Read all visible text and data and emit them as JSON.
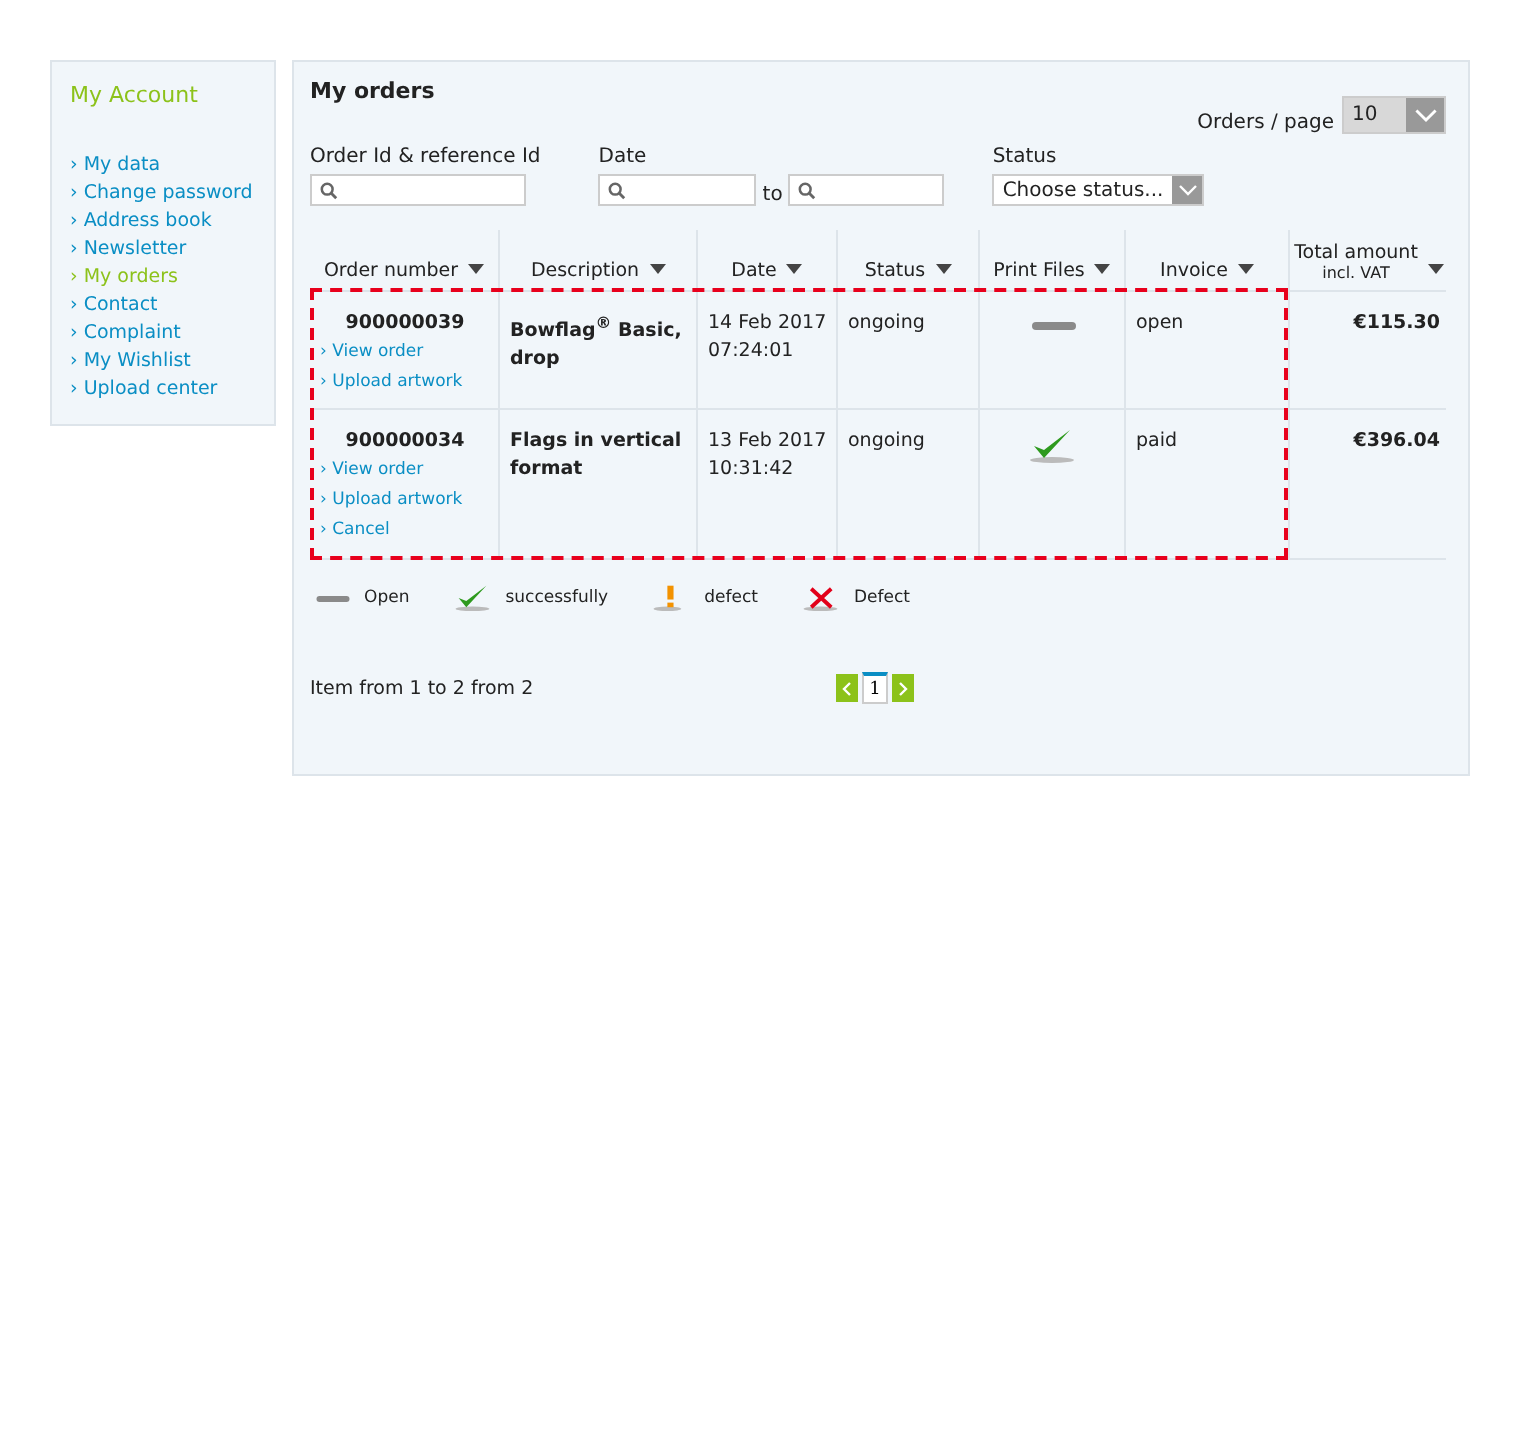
{
  "sidebar": {
    "title": "My Account",
    "items": [
      {
        "label": "› My data",
        "selected": false
      },
      {
        "label": "› Change password",
        "selected": false
      },
      {
        "label": "› Address book",
        "selected": false
      },
      {
        "label": "› Newsletter",
        "selected": false
      },
      {
        "label": "› My orders",
        "selected": true
      },
      {
        "label": "› Contact",
        "selected": false
      },
      {
        "label": "› Complaint",
        "selected": false
      },
      {
        "label": "› My Wishlist",
        "selected": false
      },
      {
        "label": "› Upload center",
        "selected": false
      }
    ]
  },
  "main": {
    "title": "My orders",
    "per_page": {
      "label": "Orders / page",
      "value": "10"
    },
    "filters": {
      "order_id": {
        "label": "Order Id & reference Id"
      },
      "date": {
        "label": "Date",
        "separator": "to"
      },
      "status": {
        "label": "Status",
        "value": "Choose status..."
      }
    },
    "table": {
      "columns": [
        {
          "label": "Order number"
        },
        {
          "label": "Description"
        },
        {
          "label": "Date"
        },
        {
          "label": "Status"
        },
        {
          "label": "Print Files"
        },
        {
          "label": "Invoice"
        },
        {
          "label": "Total amount",
          "sublabel": "incl. VAT"
        }
      ],
      "rows": [
        {
          "order_number": "900000039",
          "links": [
            "› View order",
            "› Upload artwork"
          ],
          "description": "Bowflag$^{®}$ Basic, drop",
          "date": "14 Feb 2017",
          "time": "07:24:01",
          "status": "ongoing",
          "print_files": {
            "kind": "open"
          },
          "invoice": "open",
          "total": "€115.30"
        },
        {
          "order_number": "900000034",
          "links": [
            "› View order",
            "› Upload artwork",
            "› Cancel"
          ],
          "description": "Flags in vertical format",
          "date": "13 Feb 2017",
          "time": "10:31:42",
          "status": "ongoing",
          "print_files": {
            "kind": "success"
          },
          "invoice": "paid",
          "total": "€396.04"
        }
      ]
    },
    "legend": [
      {
        "kind": "open",
        "label": "Open"
      },
      {
        "kind": "success",
        "label": "successfully"
      },
      {
        "kind": "warning",
        "label": "defect"
      },
      {
        "kind": "error",
        "label": "Defect"
      }
    ],
    "pagination": {
      "summary": "Item from 1 to 2 from 2",
      "pages": [
        {
          "label": "1",
          "selected": true
        }
      ]
    }
  }
}
